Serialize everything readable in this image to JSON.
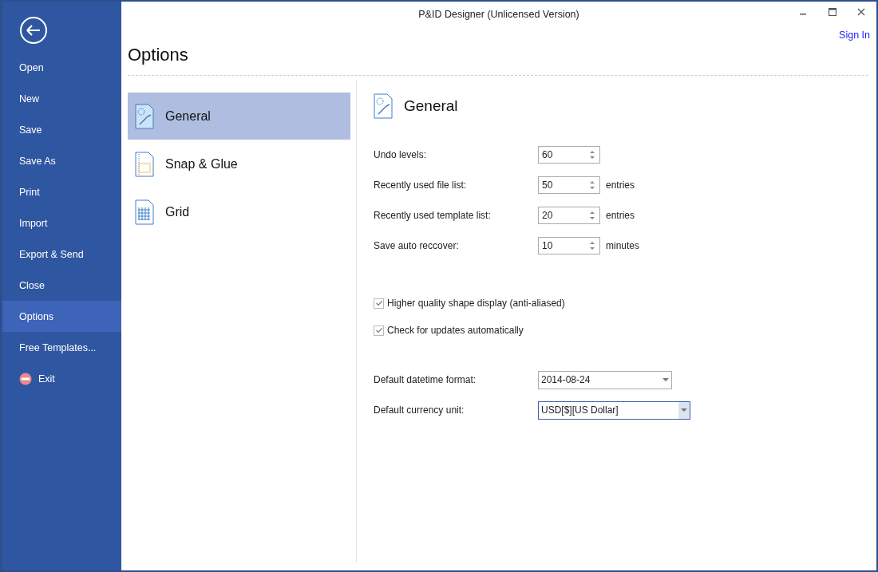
{
  "window": {
    "title": "P&ID Designer (Unlicensed Version)"
  },
  "sign_in": "Sign In",
  "sidebar": {
    "items": [
      {
        "label": "Open",
        "selected": false,
        "kind": "plain"
      },
      {
        "label": "New",
        "selected": false,
        "kind": "plain"
      },
      {
        "label": "Save",
        "selected": false,
        "kind": "plain"
      },
      {
        "label": "Save As",
        "selected": false,
        "kind": "plain"
      },
      {
        "label": "Print",
        "selected": false,
        "kind": "plain"
      },
      {
        "label": "Import",
        "selected": false,
        "kind": "plain"
      },
      {
        "label": "Export & Send",
        "selected": false,
        "kind": "plain"
      },
      {
        "label": "Close",
        "selected": false,
        "kind": "plain"
      },
      {
        "label": "Options",
        "selected": true,
        "kind": "plain"
      },
      {
        "label": "Free Templates...",
        "selected": false,
        "kind": "plain"
      },
      {
        "label": "Exit",
        "selected": false,
        "kind": "exit"
      }
    ]
  },
  "page_title": "Options",
  "categories": [
    {
      "label": "General",
      "selected": true,
      "kind": "general"
    },
    {
      "label": "Snap & Glue",
      "selected": false,
      "kind": "snap"
    },
    {
      "label": "Grid",
      "selected": false,
      "kind": "grid"
    }
  ],
  "section": {
    "title": "General"
  },
  "spinners": [
    {
      "label": "Undo levels:",
      "value": "60"
    },
    {
      "label": "Recently used file list:",
      "value": "50",
      "unit": "entries"
    },
    {
      "label": "Recently used template list:",
      "value": "20",
      "unit": "entries"
    },
    {
      "label": "Save auto reccover:",
      "value": "10",
      "unit": "minutes"
    }
  ],
  "checkboxes": [
    {
      "label": "Higher quality shape display (anti-aliased)",
      "checked": true
    },
    {
      "label": "Check for updates automatically",
      "checked": true
    }
  ],
  "dropdowns": [
    {
      "label": "Default datetime format:",
      "value": "2014-08-24",
      "focused": false
    },
    {
      "label": "Default currency unit:",
      "value": "USD[$][US Dollar]",
      "focused": true
    }
  ]
}
